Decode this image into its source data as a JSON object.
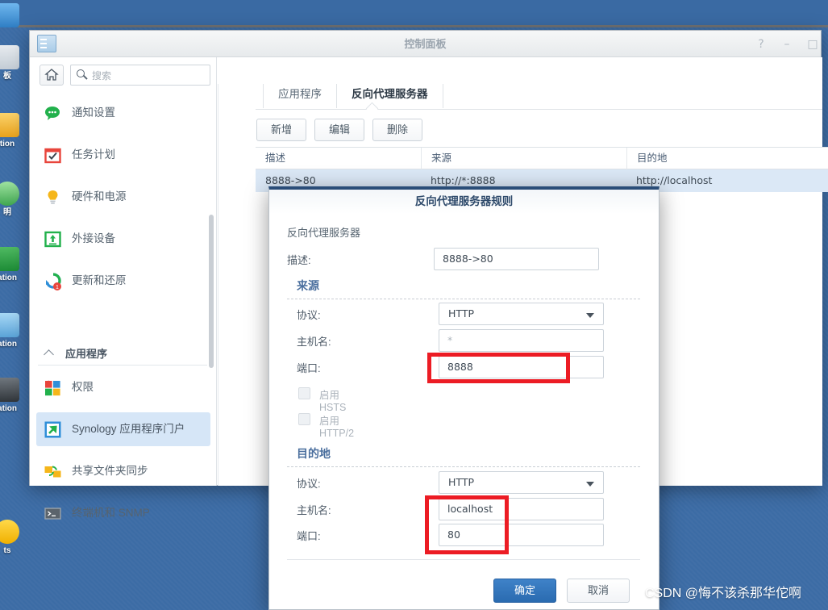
{
  "desktop": {
    "icons": [
      {
        "label": "",
        "color": "#3f8ad8"
      },
      {
        "label": "板",
        "color": "#e8453c"
      },
      {
        "label": "tion",
        "color": "#f0a32a"
      },
      {
        "label": "明",
        "color": "#4caf50"
      },
      {
        "label": "ation",
        "color": "#2e9e4a"
      },
      {
        "label": "ation",
        "color": "#6bb3e6"
      },
      {
        "label": "ation",
        "color": "#555b60"
      },
      {
        "label": "ts",
        "color": "#f5c518"
      }
    ]
  },
  "window": {
    "title": "控制面板",
    "buttons": {
      "help": "?",
      "minimize": "–",
      "maximize": "□",
      "close": "✕"
    }
  },
  "sidebar": {
    "search": {
      "placeholder": "搜索"
    },
    "home_label": "主页",
    "items": [
      {
        "label": "通知设置",
        "icon": "notification-icon"
      },
      {
        "label": "任务计划",
        "icon": "task-scheduler-icon"
      },
      {
        "label": "硬件和电源",
        "icon": "hardware-power-icon"
      },
      {
        "label": "外接设备",
        "icon": "external-devices-icon"
      },
      {
        "label": "更新和还原",
        "icon": "update-restore-icon",
        "badge": "1"
      }
    ],
    "group": {
      "label": "应用程序"
    },
    "app_items": [
      {
        "label": "权限",
        "icon": "privileges-icon",
        "selected": false
      },
      {
        "label": "Synology 应用程序门户",
        "icon": "application-portal-icon",
        "selected": true
      },
      {
        "label": "共享文件夹同步",
        "icon": "shared-folder-sync-icon",
        "selected": false
      },
      {
        "label": "终端机和 SNMP",
        "icon": "terminal-snmp-icon",
        "selected": false
      }
    ]
  },
  "main": {
    "tabs": [
      {
        "label": "应用程序",
        "active": false
      },
      {
        "label": "反向代理服务器",
        "active": true
      }
    ],
    "toolbar": [
      {
        "label": "新增",
        "name": "create-button"
      },
      {
        "label": "编辑",
        "name": "edit-button"
      },
      {
        "label": "删除",
        "name": "delete-button"
      }
    ],
    "table": {
      "columns": [
        "描述",
        "来源",
        "目的地"
      ],
      "rows": [
        {
          "description": "8888->80",
          "source": "http://*:8888",
          "destination": "http://localhost"
        }
      ]
    }
  },
  "dialog": {
    "title": "反向代理服务器规则",
    "subtitle": "反向代理服务器",
    "description": {
      "label": "描述:",
      "value": "8888->80"
    },
    "source": {
      "heading": "来源",
      "protocol": {
        "label": "协议:",
        "value": "HTTP"
      },
      "hostname": {
        "label": "主机名:",
        "value": "*"
      },
      "port": {
        "label": "端口:",
        "value": "8888"
      },
      "hsts": {
        "label": "启用 HSTS",
        "checked": false
      },
      "http2": {
        "label": "启用 HTTP/2",
        "checked": false
      }
    },
    "destination": {
      "heading": "目的地",
      "protocol": {
        "label": "协议:",
        "value": "HTTP"
      },
      "hostname": {
        "label": "主机名:",
        "value": "localhost"
      },
      "port": {
        "label": "端口:",
        "value": "80"
      }
    },
    "ok_label": "确定",
    "cancel_label": "取消",
    "highlight_color": "#ec1c24"
  },
  "watermark": {
    "text": "CSDN @悔不该杀那华佗啊"
  }
}
